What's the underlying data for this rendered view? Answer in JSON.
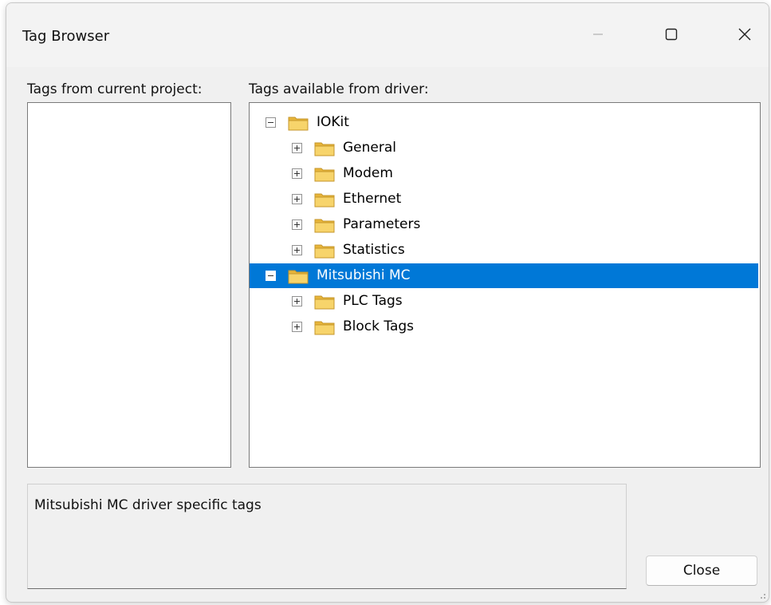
{
  "window": {
    "title": "Tag Browser"
  },
  "labels": {
    "current_project": "Tags from current project:",
    "driver": "Tags available from driver:"
  },
  "tree": [
    {
      "label": "IOKit",
      "expander": "minus",
      "level": 0,
      "selected": false
    },
    {
      "label": "General",
      "expander": "plus",
      "level": 1,
      "selected": false
    },
    {
      "label": "Modem",
      "expander": "plus",
      "level": 1,
      "selected": false
    },
    {
      "label": "Ethernet",
      "expander": "plus",
      "level": 1,
      "selected": false
    },
    {
      "label": "Parameters",
      "expander": "plus",
      "level": 1,
      "selected": false
    },
    {
      "label": "Statistics",
      "expander": "plus",
      "level": 1,
      "selected": false
    },
    {
      "label": "Mitsubishi MC",
      "expander": "minus",
      "level": 0,
      "selected": true
    },
    {
      "label": "PLC Tags",
      "expander": "plus",
      "level": 1,
      "selected": false
    },
    {
      "label": "Block Tags",
      "expander": "plus",
      "level": 1,
      "selected": false
    }
  ],
  "description": "Mitsubishi MC driver specific tags",
  "buttons": {
    "close": "Close"
  },
  "colors": {
    "selection": "#0078d7",
    "folder": "#f2c94c"
  },
  "icons": {
    "folder": "folder-icon",
    "minimize": "minimize-icon",
    "maximize": "maximize-icon",
    "close": "close-icon"
  }
}
